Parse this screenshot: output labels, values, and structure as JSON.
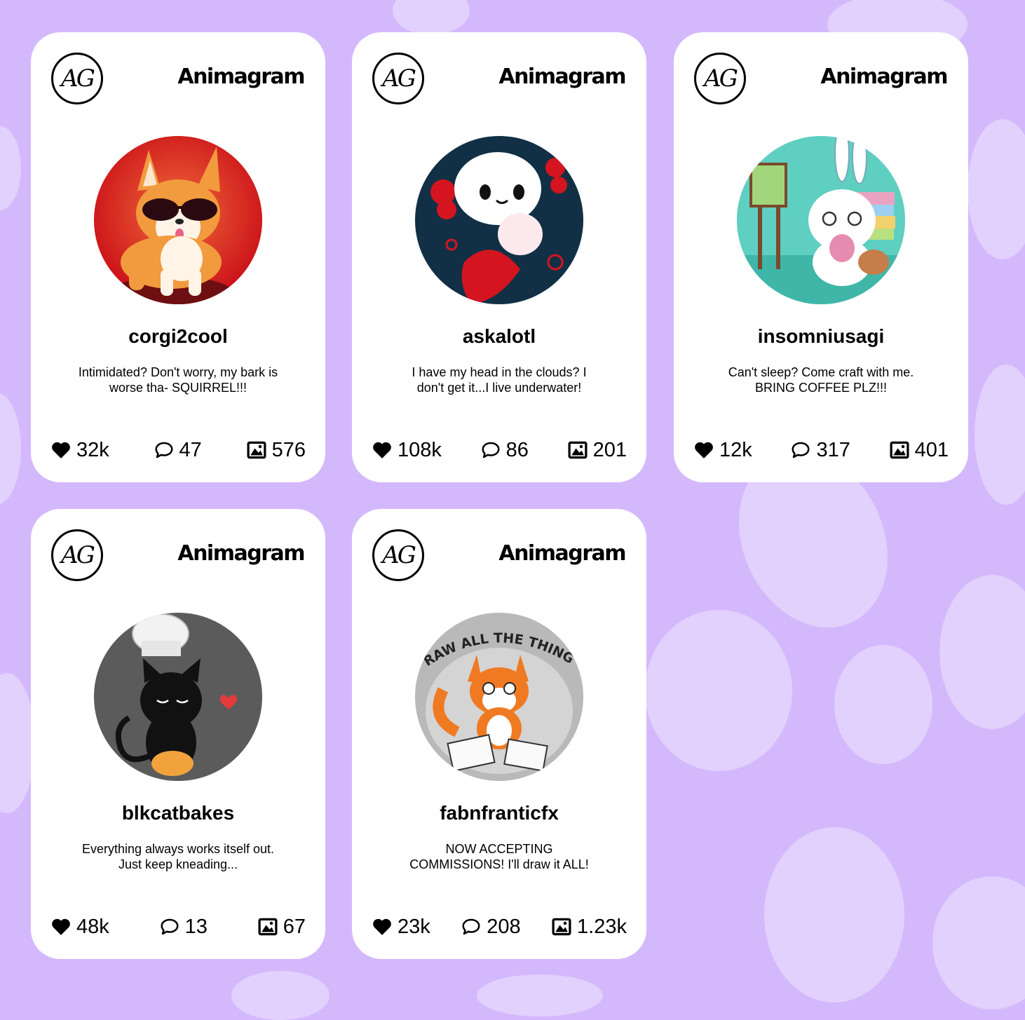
{
  "theme": {
    "background": "#d4b8fc",
    "blob": "#e2d0fd",
    "card": "#ffffff"
  },
  "brand": {
    "logo_text": "AG",
    "name": "Animagram"
  },
  "icons": {
    "likes": "heart-icon",
    "comments": "comment-icon",
    "posts": "image-icon"
  },
  "cards": [
    {
      "username": "corgi2cool",
      "bio": "Intimidated? Don't worry, my bark is worse tha- SQUIRREL!!!",
      "likes": "32k",
      "comments": "47",
      "posts": "576",
      "avatar": "corgi-avatar"
    },
    {
      "username": "askalotl",
      "bio": "I have my head in the clouds? I don't get it...I live underwater!",
      "likes": "108k",
      "comments": "86",
      "posts": "201",
      "avatar": "axolotl-avatar"
    },
    {
      "username": "insomniusagi",
      "bio": "Can't sleep? Come craft with me. BRING COFFEE PLZ!!!",
      "likes": "12k",
      "comments": "317",
      "posts": "401",
      "avatar": "bunny-avatar"
    },
    {
      "username": "blkcatbakes",
      "bio": "Everything always works itself out. Just keep kneading...",
      "likes": "48k",
      "comments": "13",
      "posts": "67",
      "avatar": "black-cat-avatar"
    },
    {
      "username": "fabnfranticfx",
      "bio": "NOW ACCEPTING COMMISSIONS! I'll draw it ALL!",
      "likes": "23k",
      "comments": "208",
      "posts": "1.23k",
      "avatar": "fox-avatar",
      "avatar_text": "DRAW ALL THE THINGS!"
    }
  ]
}
